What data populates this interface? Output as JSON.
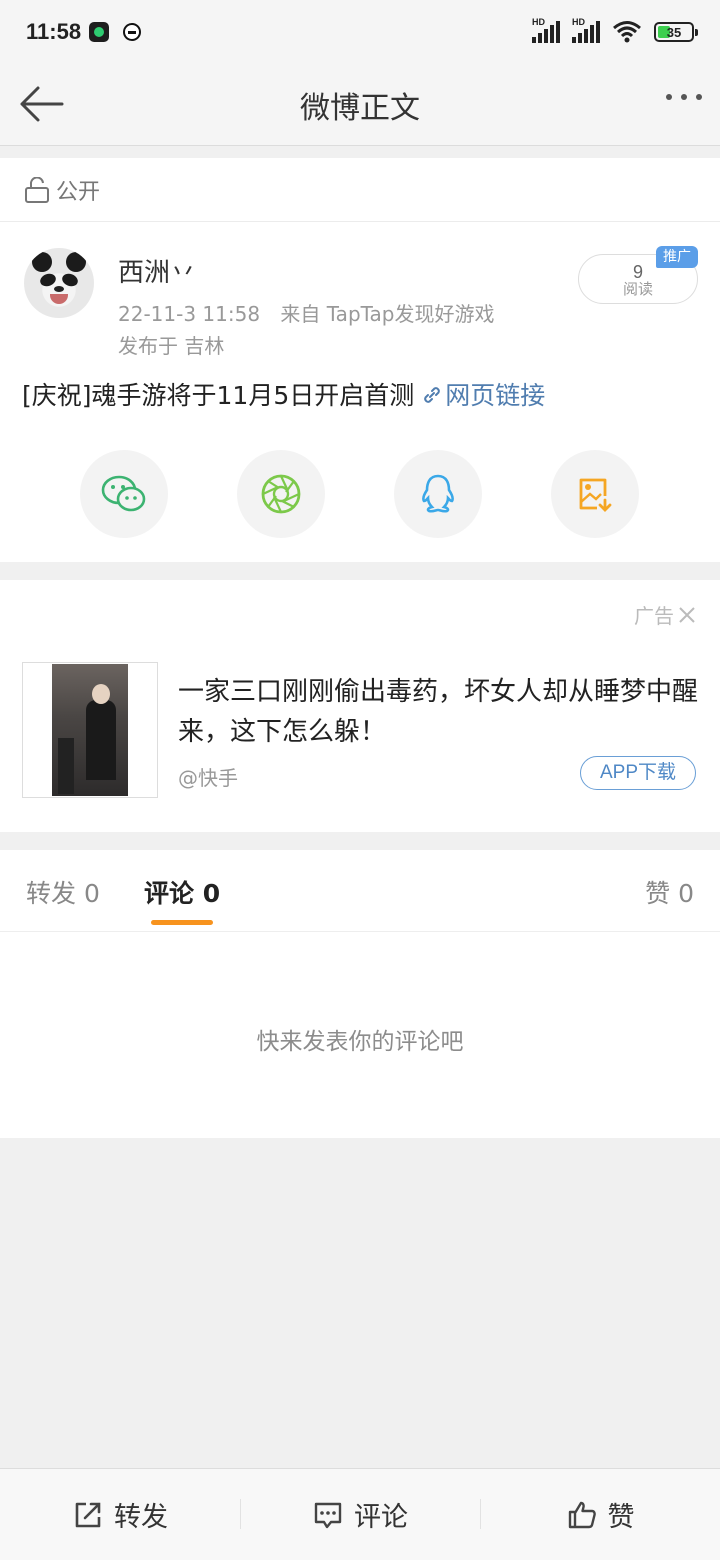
{
  "status_bar": {
    "time": "11:58",
    "battery": "35",
    "net1": "HD",
    "net2": "HD"
  },
  "nav": {
    "title": "微博正文"
  },
  "visibility": {
    "label": "公开"
  },
  "post": {
    "author": "西洲丷",
    "date": "22-11-3 11:58",
    "source": "来自 TapTap发现好游戏",
    "location": "发布于 吉林",
    "read_count": "9",
    "read_label": "阅读",
    "promo_badge": "推广",
    "text": "[庆祝]魂手游将于11月5日开启首测",
    "link_text": "网页链接"
  },
  "share_icons": [
    "wechat-icon",
    "moments-icon",
    "qq-icon",
    "save-image-icon"
  ],
  "ad": {
    "tag": "广告",
    "title": "一家三口刚刚偷出毒药，坏女人却从睡梦中醒来，这下怎么躲！",
    "source": "@快手",
    "download": "APP下载"
  },
  "tabs": {
    "repost": "转发 0",
    "comment": "评论 0",
    "like": "赞 0"
  },
  "empty_comments": "快来发表你的评论吧",
  "bottom": {
    "repost": "转发",
    "comment": "评论",
    "like": "赞"
  },
  "colors": {
    "accent": "#f7931e",
    "link": "#507daf",
    "promo": "#5b9ee8"
  }
}
